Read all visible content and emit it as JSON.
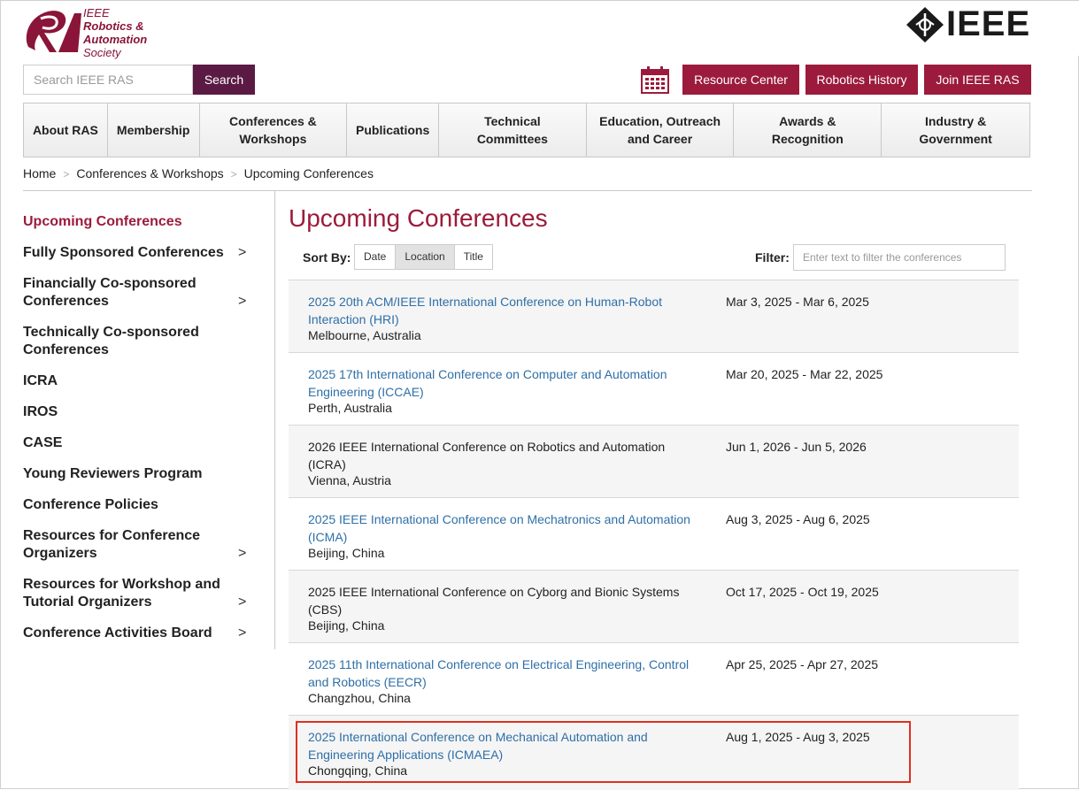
{
  "header": {
    "ras_logo_text": [
      "IEEE",
      "Robotics &",
      "Automation",
      "Society"
    ],
    "ieee_logo_text": "IEEE"
  },
  "search": {
    "placeholder": "Search IEEE RAS",
    "button": "Search"
  },
  "utility_buttons": [
    "Resource Center",
    "Robotics History",
    "Join IEEE RAS"
  ],
  "nav": [
    "About RAS",
    "Membership",
    "Conferences & Workshops",
    "Publications",
    "Technical Committees",
    "Education, Outreach and Career",
    "Awards & Recognition",
    "Industry & Government"
  ],
  "breadcrumb": [
    "Home",
    "Conferences & Workshops",
    "Upcoming Conferences"
  ],
  "sidebar": [
    {
      "label": "Upcoming Conferences",
      "active": true,
      "has_children": false
    },
    {
      "label": "Fully Sponsored Conferences",
      "has_children": true
    },
    {
      "label": "Financially Co-sponsored Conferences",
      "has_children": true
    },
    {
      "label": "Technically Co-sponsored Conferences",
      "has_children": false
    },
    {
      "label": "ICRA",
      "has_children": false
    },
    {
      "label": "IROS",
      "has_children": false
    },
    {
      "label": "CASE",
      "has_children": false
    },
    {
      "label": "Young Reviewers Program",
      "has_children": false
    },
    {
      "label": "Conference Policies",
      "has_children": false
    },
    {
      "label": "Resources for Conference Organizers",
      "has_children": true
    },
    {
      "label": "Resources for Workshop and Tutorial Organizers",
      "has_children": true
    },
    {
      "label": "Conference Activities Board",
      "has_children": true
    }
  ],
  "main": {
    "title": "Upcoming Conferences",
    "sort_label": "Sort By:",
    "sort_options": [
      "Date",
      "Location",
      "Title"
    ],
    "sort_selected": "Location",
    "filter_label": "Filter:",
    "filter_placeholder": "Enter text to filter the conferences",
    "conferences": [
      {
        "title": "2025 20th ACM/IEEE International Conference on Human-Robot Interaction (HRI)",
        "location": "Melbourne, Australia",
        "dates": "Mar 3, 2025 - Mar 6, 2025",
        "link": true
      },
      {
        "title": "2025 17th International Conference on Computer and Automation Engineering (ICCAE)",
        "location": "Perth, Australia",
        "dates": "Mar 20, 2025 - Mar 22, 2025",
        "link": true
      },
      {
        "title": "2026 IEEE International Conference on Robotics and Automation (ICRA)",
        "location": "Vienna, Austria",
        "dates": "Jun 1, 2026 - Jun 5, 2026",
        "link": false
      },
      {
        "title": "2025 IEEE International Conference on Mechatronics and Automation (ICMA)",
        "location": "Beijing, China",
        "dates": "Aug 3, 2025 - Aug 6, 2025",
        "link": true
      },
      {
        "title": "2025 IEEE International Conference on Cyborg and Bionic Systems (CBS)",
        "location": "Beijing, China",
        "dates": "Oct 17, 2025 - Oct 19, 2025",
        "link": false
      },
      {
        "title": "2025 11th International Conference on Electrical Engineering, Control and Robotics (EECR)",
        "location": "Changzhou, China",
        "dates": "Apr 25, 2025 - Apr 27, 2025",
        "link": true
      },
      {
        "title": "2025 International Conference on Mechanical Automation and Engineering Applications (ICMAEA)",
        "location": "Chongqing, China",
        "dates": "Aug 1, 2025 - Aug 3, 2025",
        "link": true
      }
    ]
  },
  "colors": {
    "accent": "#9c1b3c",
    "search_button": "#5b1a44",
    "link": "#2e6fa7",
    "highlight": "#e0301e"
  }
}
